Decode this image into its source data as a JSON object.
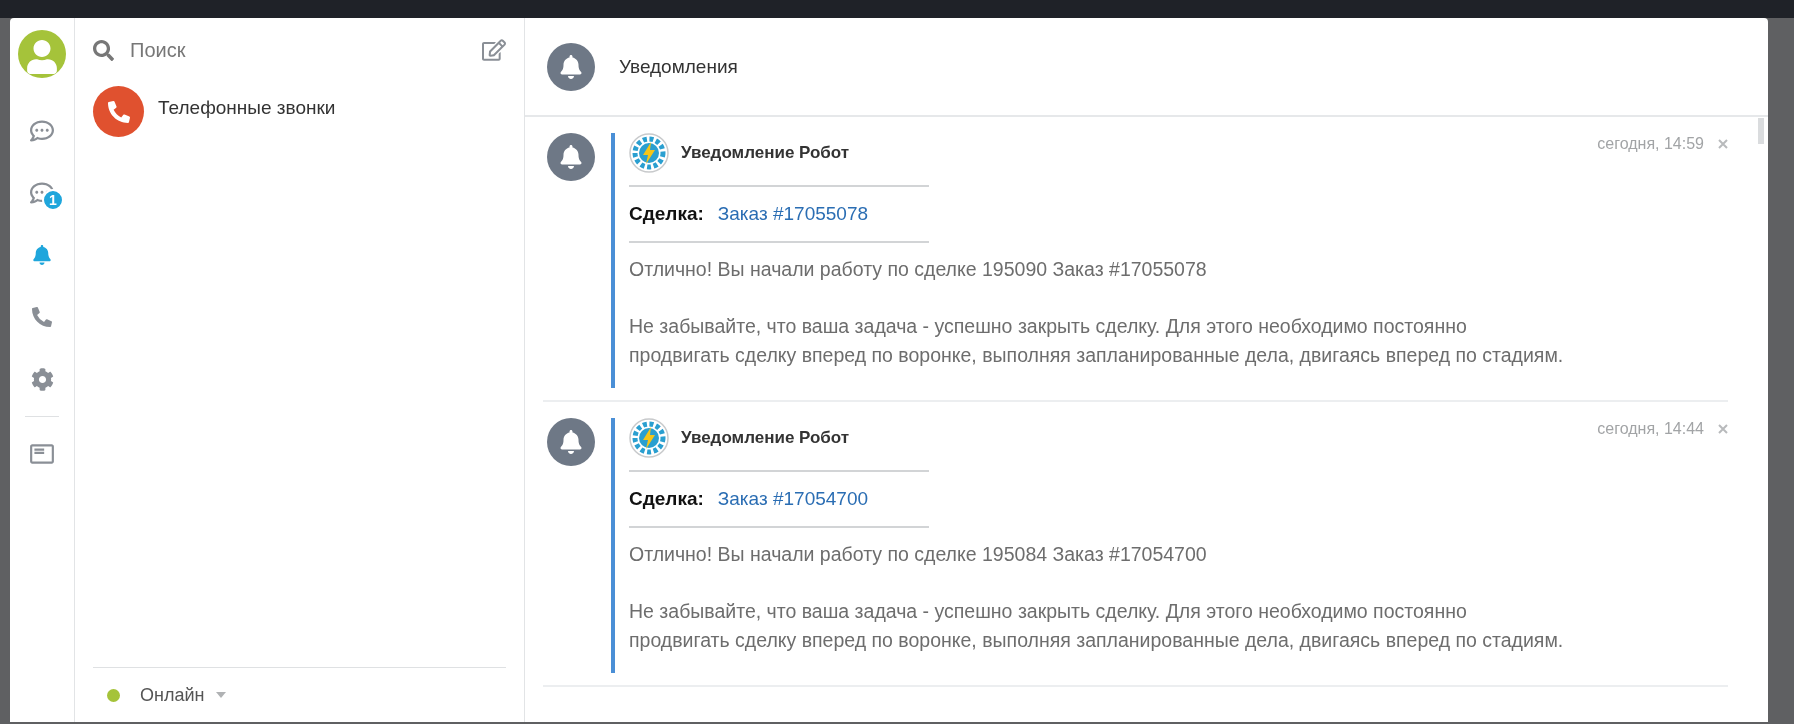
{
  "sidebar": {
    "items": [
      {
        "kind": "chat",
        "selected": false
      },
      {
        "kind": "list",
        "selected": false,
        "badge": "1"
      },
      {
        "kind": "bell",
        "selected": true
      },
      {
        "kind": "phone",
        "selected": false
      },
      {
        "kind": "gear",
        "selected": false
      },
      {
        "kind": "export",
        "selected": false
      }
    ]
  },
  "contacts": {
    "search": {
      "placeholder": "Поиск"
    },
    "items": [
      {
        "name": "Телефонные звонки"
      }
    ],
    "status": {
      "label": "Онлайн",
      "color": "#a5c33a"
    }
  },
  "main": {
    "title": "Уведомления",
    "notifications": [
      {
        "sender": "Уведомление Робот",
        "time": "сегодня, 14:59",
        "deal_label": "Сделка:",
        "deal_link": "Заказ #17055078",
        "paragraphs": [
          "Отлично! Вы начали работу по сделке 195090 Заказ #17055078",
          "Не забывайте, что ваша задача - успешно закрыть сделку. Для этого необходимо постоянно продвигать сделку вперед по воронке, выполняя запланированные дела, двигаясь вперед по стадиям."
        ]
      },
      {
        "sender": "Уведомление Робот",
        "time": "сегодня, 14:44",
        "deal_label": "Сделка:",
        "deal_link": "Заказ #17054700",
        "paragraphs": [
          "Отлично! Вы начали работу по сделке 195084 Заказ #17054700",
          "Не забывайте, что ваша задача - успешно закрыть сделку. Для этого необходимо постоянно продвигать сделку вперед по воронке, выполняя запланированные дела, двигаясь вперед по стадиям."
        ]
      }
    ]
  }
}
